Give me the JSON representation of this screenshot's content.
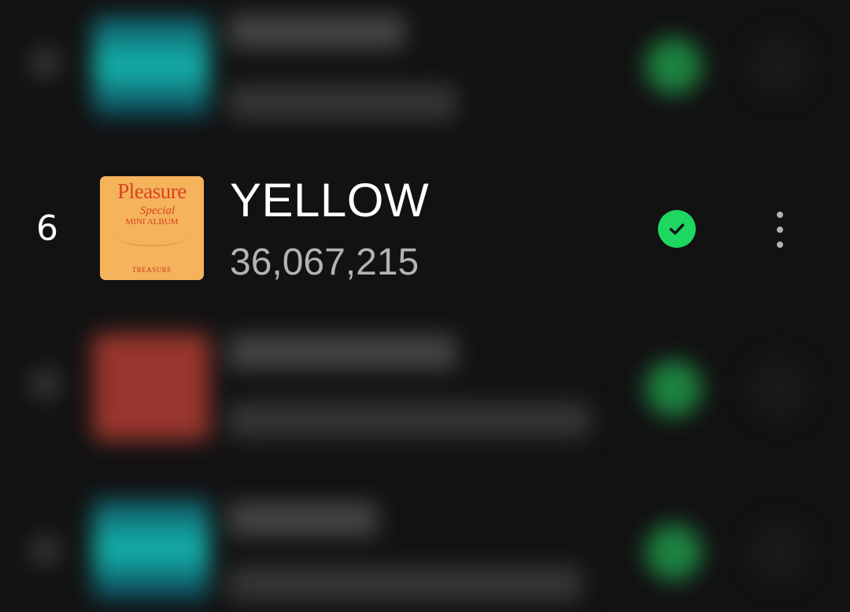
{
  "track": {
    "rank": "6",
    "title": "YELLOW",
    "play_count": "36,067,215",
    "saved": true,
    "album_art": {
      "title": "Pleasure",
      "subtitle": "Special",
      "subtitle2": "MINI ALBUM",
      "footer": "TREASURE",
      "background_color": "#f5b35c",
      "text_color": "#d9431f"
    }
  },
  "icons": {
    "saved": "check-circle-icon",
    "more": "more-vertical-icon"
  },
  "colors": {
    "background": "#121212",
    "title": "#ffffff",
    "secondary_text": "#b3b3b3",
    "accent_green": "#1ed760"
  }
}
